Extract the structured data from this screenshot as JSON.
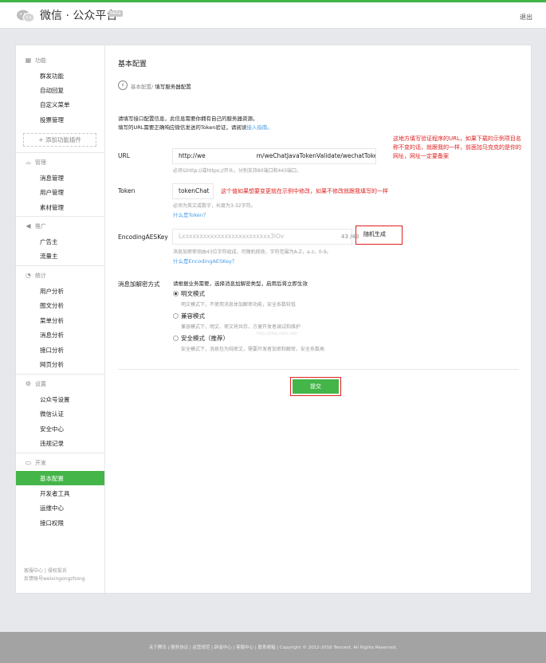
{
  "header": {
    "app_title": "微信 · 公众平台",
    "badge": "beta",
    "logout": "退出"
  },
  "sidebar": {
    "sections": [
      {
        "icon": "grid-icon",
        "title": "功能",
        "items": [
          "群发功能",
          "自动回复",
          "自定义菜单",
          "投票管理"
        ]
      },
      {
        "icon": "tray-icon",
        "title": "管理",
        "items": [
          "消息管理",
          "用户管理",
          "素材管理"
        ]
      },
      {
        "icon": "megaphone-icon",
        "title": "推广",
        "items": [
          "广告主",
          "流量主"
        ]
      },
      {
        "icon": "pie-chart-icon",
        "title": "统计",
        "items": [
          "用户分析",
          "图文分析",
          "菜单分析",
          "消息分析",
          "接口分析",
          "网页分析"
        ]
      },
      {
        "icon": "gear-icon",
        "title": "设置",
        "items": [
          "公众号设置",
          "微信认证",
          "安全中心",
          "违规记录"
        ]
      },
      {
        "icon": "code-icon",
        "title": "开发",
        "items": [
          "基本配置",
          "开发者工具",
          "运维中心",
          "接口权限"
        ]
      }
    ],
    "add_plugin": "+ 添加功能插件",
    "active_item": "基本配置",
    "footer_line1": "客服中心 | 侵权投诉",
    "footer_line2": "反馈账号weixingongzhong"
  },
  "content": {
    "title": "基本配置",
    "breadcrumb_parent": "基本配置/",
    "breadcrumb_current": "填写服务器配置",
    "intro_line1": "请填写接口配置信息，此信息需要你拥有自己的服务器资源。",
    "intro_line2": "填写的URL需要正确响应微信发送的Token验证，请阅读",
    "intro_link": "接入指南。",
    "url": {
      "label": "URL",
      "value_left": "http://we",
      "value_right": "m/weChatJavaTokenValidate/wechatToken",
      "hint": "必须以http://或https://开头，分别支持80端口和443端口。"
    },
    "url_annotation": [
      "这地方填写验证程序的URL，如果下载的示例项目名",
      "称不变的话，就跟我的一样，前面加马克克的是你的",
      "网址，网址一定要备案"
    ],
    "token": {
      "label": "Token",
      "value": "tokenChat",
      "annotation": "这个值如果想要变更就在示例中修改，如果不修改就跟我填写的一样",
      "hint": "必须为英文或数字，长度为3-32字符。",
      "link": "什么是Token？"
    },
    "aeskey": {
      "label": "EncodingAESKey",
      "value": "Lxxxxxxxxxxxxxxxxxxxxxxxxx3lOv",
      "count": "43 /43",
      "generate": "随机生成",
      "hint": "消息加密密钥由43位字符组成，可随机修改，字符范围为A-Z，a-z，0-9。",
      "link": "什么是EncodingAESKey？"
    },
    "encrypt": {
      "label": "消息加解密方式",
      "intro": "请根据业务需要，选择消息加解密类型，启用后将立即生效",
      "options": [
        {
          "name": "明文模式",
          "desc": "明文模式下，不使用消息体加解密功能，安全系数较低",
          "selected": true
        },
        {
          "name": "兼容模式",
          "desc": "兼容模式下，明文、密文将共存，方便开发者调试和维护",
          "selected": false
        },
        {
          "name": "安全模式（推荐）",
          "desc": "安全模式下，消息包为纯密文，需要开发者加密和解密，安全系数高",
          "selected": false
        }
      ]
    },
    "watermark": "http://blog.csdn.net/",
    "submit": "提交"
  },
  "footer": {
    "text": "关于腾讯  |  服务协议  |  运营规范  |  辟谣中心  |  客服中心  |  联系邮箱  |  Copyright © 2012-2016 Tencent. All Rights Reserved."
  },
  "colors": {
    "brand_green": "#44b549",
    "annotation_red": "#e02020",
    "link_blue": "#459ae9"
  }
}
